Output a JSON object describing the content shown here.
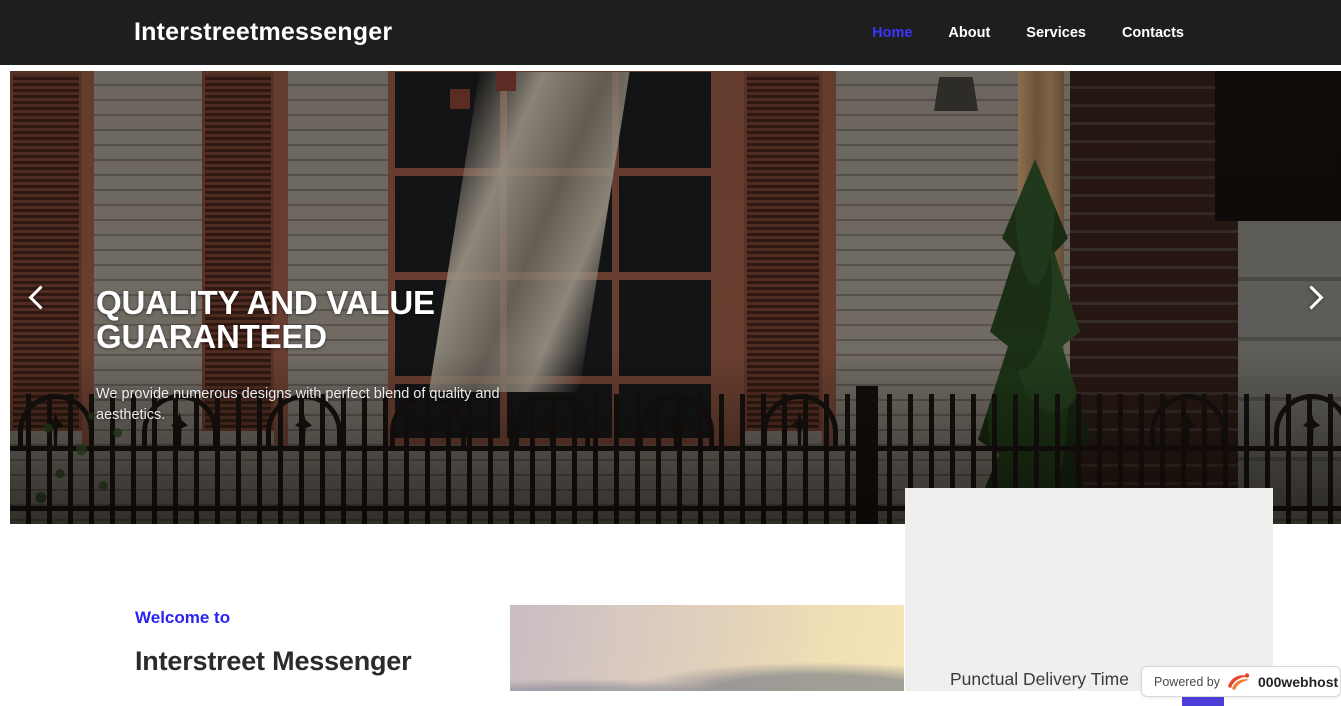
{
  "header": {
    "brand": "Interstreetmessenger",
    "nav": [
      {
        "label": "Home",
        "active": true
      },
      {
        "label": "About",
        "active": false
      },
      {
        "label": "Services",
        "active": false
      },
      {
        "label": "Contacts",
        "active": false
      }
    ],
    "background_color": "#1e1e1e",
    "active_link_color": "#3b35ff"
  },
  "hero": {
    "title": "QUALITY AND VALUE GUARANTEED",
    "subtitle": "We provide numerous designs with perfect blend of quality and aesthetics.",
    "prev_icon": "chevron-left-icon",
    "next_icon": "chevron-right-icon",
    "image_description": "house facade with red door, shutters, windows, evergreen tree, brick wall and wrought iron fence"
  },
  "welcome": {
    "eyebrow": "Welcome to",
    "heading": "Interstreet Messenger",
    "eyebrow_color": "#2b24f0",
    "image_description": "sunset sky with clouds"
  },
  "widget": {
    "caption": "Punctual Delivery Time",
    "panel_color": "#efefed"
  },
  "webhost_badge": {
    "powered_by": "Powered by",
    "name": "000webhost",
    "logo_icon": "000webhost-swoosh-icon"
  }
}
